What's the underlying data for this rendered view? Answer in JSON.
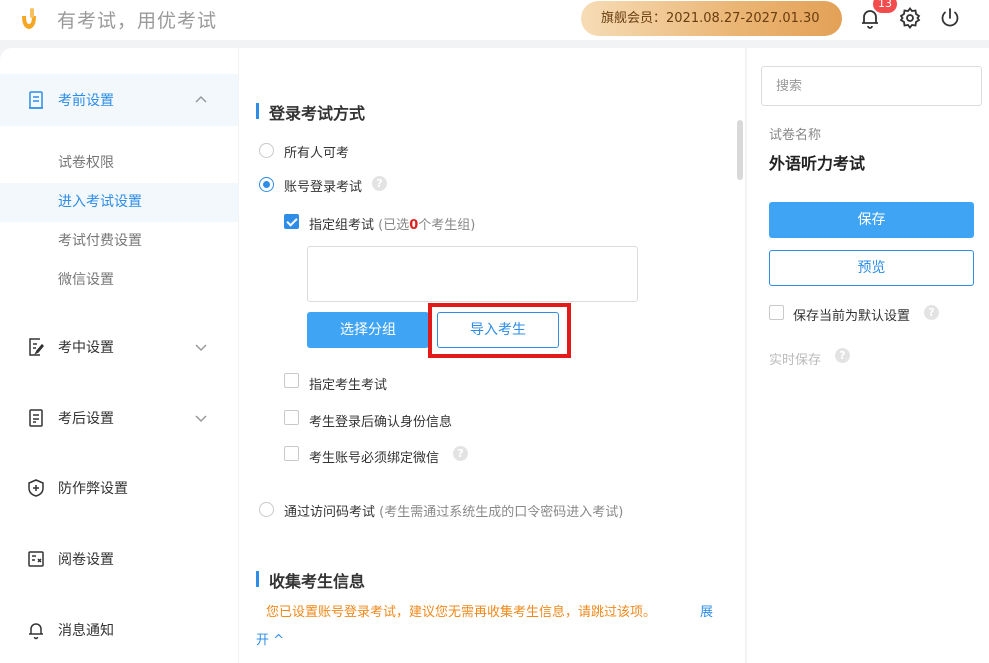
{
  "header": {
    "slogan": "有考试，用优考试",
    "vip_text": "旗舰会员：2021.08.27-2027.01.30",
    "notification_count": "13",
    "brand_color": "#f5a623"
  },
  "sidebar": {
    "groups": [
      {
        "label": "考前设置",
        "icon": "document-icon",
        "expanded": true
      },
      {
        "label": "考中设置",
        "icon": "edit-icon",
        "expanded": false
      },
      {
        "label": "考后设置",
        "icon": "score-icon",
        "expanded": false
      },
      {
        "label": "防作弊设置",
        "icon": "shield-icon"
      },
      {
        "label": "阅卷设置",
        "icon": "grading-icon"
      },
      {
        "label": "消息通知",
        "icon": "bell-icon"
      }
    ],
    "sub_items": [
      "试卷权限",
      "进入考试设置",
      "考试付费设置",
      "微信设置"
    ],
    "active_sub_item": "进入考试设置"
  },
  "main": {
    "login_section_title": "登录考试方式",
    "options": {
      "everyone": "所有人可考",
      "account_login": "账号登录考试",
      "group_exam": "指定组考试",
      "group_hint_prefix": "(已选",
      "group_hint_count": "0",
      "group_hint_suffix": "个考生组)",
      "select_group_button": "选择分组",
      "import_button": "导入考生",
      "specified_candidate": "指定考生考试",
      "confirm_identity": "考生登录后确认身份信息",
      "bind_wechat": "考生账号必须绑定微信",
      "access_code": "通过访问码考试",
      "access_code_hint": "(考生需通过系统生成的口令密码进入考试)"
    },
    "collect_section_title": "收集考生信息",
    "collect_warning": "您已设置账号登录考试，建议您无需再收集考生信息，请跳过该项。",
    "expand_link_part1": "展",
    "expand_link_part2": "开 ^"
  },
  "right_panel": {
    "search_placeholder": "搜索",
    "paper_label": "试卷名称",
    "paper_name": "外语听力考试",
    "save_button": "保存",
    "preview_button": "预览",
    "default_setting_label": "保存当前为默认设置",
    "realtime_save_label": "实时保存"
  },
  "help_glyph": "?",
  "colors": {
    "accent": "#2e8de6",
    "primary_button": "#40a4f5",
    "highlight": "#e21a1a",
    "warning": "#f0891b"
  }
}
